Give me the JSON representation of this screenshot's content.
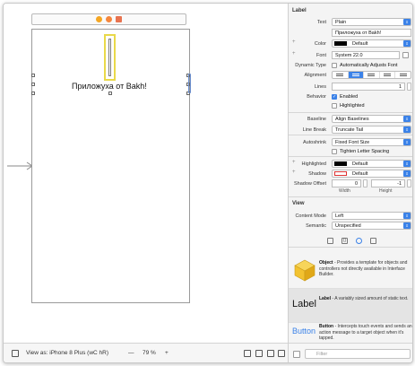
{
  "canvas": {
    "label_text": "Приложуха от Bakh!"
  },
  "bottom_bar": {
    "view_as": "View as: iPhone 8 Plus (wC hR)",
    "zoom_minus": "—",
    "zoom_level": "79 %",
    "zoom_plus": "+"
  },
  "inspector": {
    "label_section": "Label",
    "text_label": "Text",
    "text_value": "Plain",
    "text_content": "Приложуха от Bakh!",
    "color_label": "Color",
    "color_value": "Default",
    "font_label": "Font",
    "font_value": "System 22.0",
    "dynamic_type_label": "Dynamic Type",
    "dynamic_type_value": "Automatically Adjusts Font",
    "alignment_label": "Alignment",
    "lines_label": "Lines",
    "lines_value": "1",
    "behavior_label": "Behavior",
    "enabled_label": "Enabled",
    "highlighted_cb_label": "Highlighted",
    "baseline_label": "Baseline",
    "baseline_value": "Align Baselines",
    "line_break_label": "Line Break",
    "line_break_value": "Truncate Tail",
    "autoshrink_label": "Autoshrink",
    "autoshrink_value": "Fixed Font Size",
    "tighten_label": "Tighten Letter Spacing",
    "highlighted_label": "Highlighted",
    "highlighted_value": "Default",
    "shadow_label": "Shadow",
    "shadow_value": "Default",
    "shadow_offset_label": "Shadow Offset",
    "shadow_offset_width": "0",
    "shadow_offset_height": "-1",
    "width_caption": "Width",
    "height_caption": "Height",
    "view_section": "View",
    "content_mode_label": "Content Mode",
    "content_mode_value": "Left",
    "semantic_label": "Semantic",
    "semantic_value": "Unspecified"
  },
  "library": {
    "object_title": "Object",
    "object_desc": " - Provides a template for objects and controllers not directly available in Interface Builder.",
    "label_icon_text": "Label",
    "label_title": "Label",
    "label_desc": " - A variably sized amount of static text.",
    "button_icon_text": "Button",
    "button_title": "Button",
    "button_desc": " - Intercepts touch events and sends an action message to a target object when it's tapped.",
    "filter_placeholder": "Filter"
  },
  "colors": {
    "accent": "#3b82e8",
    "selection_yellow": "#e9d94a",
    "object_cube": "#f2c230"
  }
}
